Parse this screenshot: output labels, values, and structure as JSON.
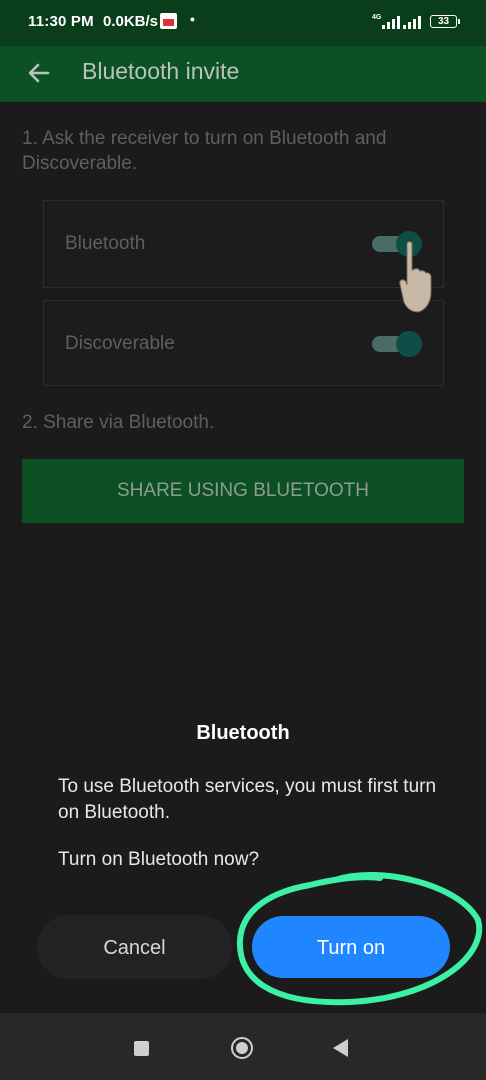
{
  "status_bar": {
    "time": "11:30 PM",
    "net_speed": "0.0KB/s",
    "dot": "•",
    "network": "4G",
    "battery": "33"
  },
  "app_bar": {
    "title": "Bluetooth invite",
    "back_icon": "arrow-left-icon"
  },
  "content": {
    "instruction_1": "1. Ask the receiver to turn on Bluetooth and Discoverable.",
    "instruction_2": "2. Share via Bluetooth.",
    "toggles": [
      {
        "label": "Bluetooth",
        "on": true
      },
      {
        "label": "Discoverable",
        "on": true
      }
    ],
    "share_button": "SHARE USING BLUETOOTH"
  },
  "dialog": {
    "title": "Bluetooth",
    "message": "To use Bluetooth services, you must first turn on Bluetooth.",
    "question": "Turn on Bluetooth now?",
    "cancel": "Cancel",
    "confirm": "Turn on",
    "annotation_color": "#3cf0a4"
  },
  "nav_bar": {
    "icons": [
      "recent-apps-icon",
      "home-icon",
      "back-icon"
    ]
  },
  "colors": {
    "app_bar": "#0c5126",
    "share_button": "#0b4f22",
    "primary_button": "#1f86ff",
    "toggle_thumb": "#0d4f46"
  }
}
